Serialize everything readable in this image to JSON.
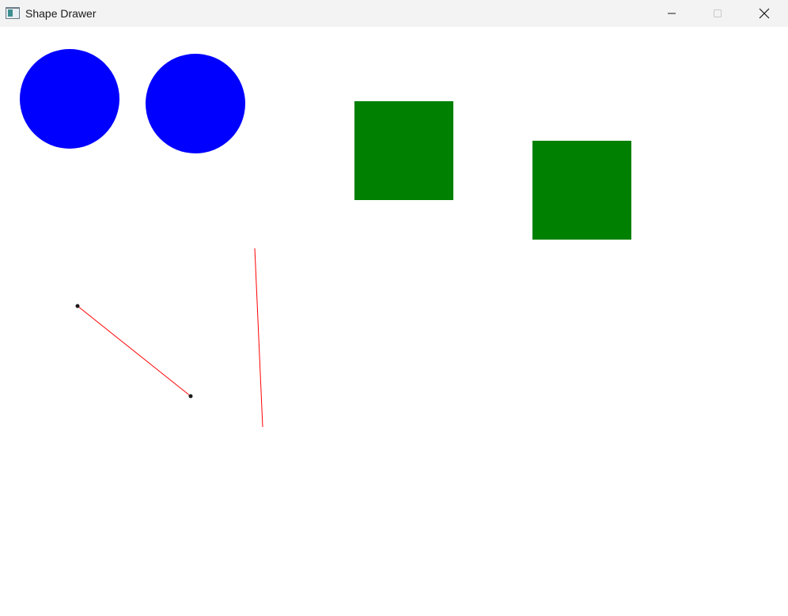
{
  "window": {
    "title": "Shape Drawer",
    "controls": {
      "minimize": "minimize-icon",
      "maximize": "maximize-icon",
      "close": "close-icon"
    }
  },
  "colors": {
    "circle_fill": "#0000ff",
    "square_fill": "#008000",
    "line_stroke": "#ff0000",
    "endpoint_marker": "#1a1a1a",
    "titlebar_bg": "#f3f3f3",
    "canvas_bg": "#ffffff"
  },
  "shapes": {
    "circles": [
      "circle-1",
      "circle-2"
    ],
    "squares": [
      "square-1",
      "square-2"
    ],
    "lines": [
      "line-1",
      "line-2"
    ]
  }
}
